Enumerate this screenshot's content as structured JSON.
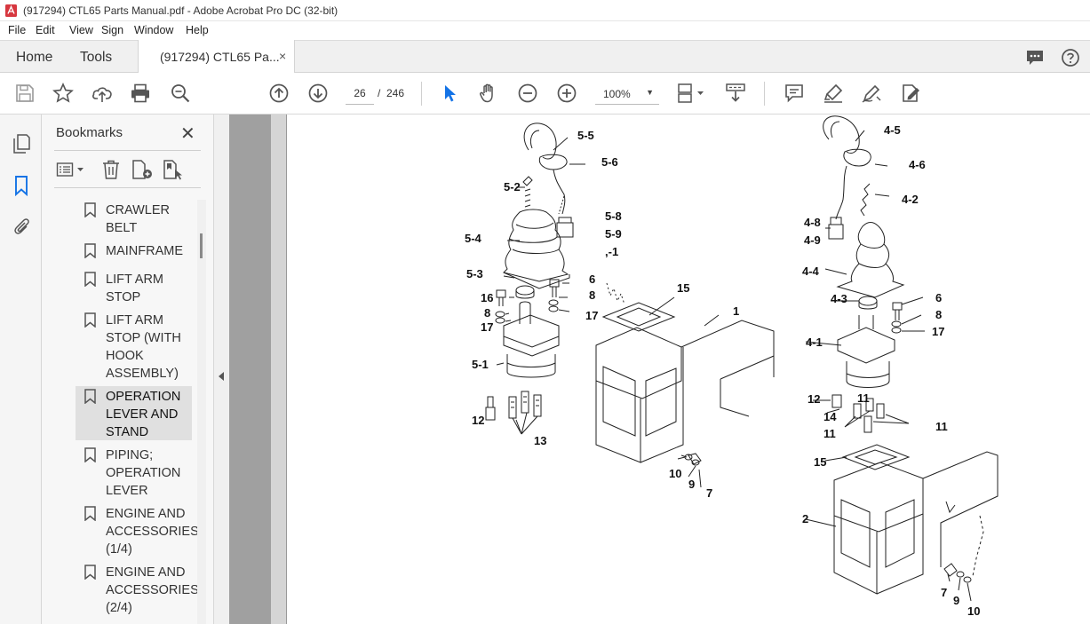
{
  "window": {
    "title": "(917294) CTL65 Parts Manual.pdf - Adobe Acrobat Pro DC (32-bit)"
  },
  "menu": [
    "File",
    "Edit",
    "View",
    "Sign",
    "Window",
    "Help"
  ],
  "tabs": {
    "home": "Home",
    "tools": "Tools",
    "document": "(917294) CTL65 Pa...",
    "close_glyph": "×"
  },
  "toolbar": {
    "page_current": "26",
    "page_separator": "/",
    "page_total": "246",
    "zoom": "100%",
    "zoom_arrow": "▼",
    "icons": [
      "save-icon",
      "bookmark-star-icon",
      "upload-icon",
      "print-icon",
      "search-zoom-icon",
      "page-up-icon",
      "page-down-icon",
      "select-cursor-icon",
      "hand-icon",
      "zoom-out-icon",
      "zoom-in-icon",
      "page-view-icon",
      "scroll-mode-icon",
      "comment-icon",
      "highlight-icon",
      "draw-icon",
      "fill-sign-icon"
    ]
  },
  "bookmarks": {
    "title": "Bookmarks",
    "close_glyph": "✕",
    "items": [
      {
        "label": "CRAWLER BELT"
      },
      {
        "label": "MAINFRAME"
      },
      {
        "label": "LIFT ARM STOP"
      },
      {
        "label": "LIFT ARM STOP (WITH HOOK ASSEMBLY)"
      },
      {
        "label": "OPERATION LEVER AND STAND",
        "selected": true
      },
      {
        "label": "PIPING; OPERATION LEVER"
      },
      {
        "label": "ENGINE AND ACCESSORIES (1/4)"
      },
      {
        "label": "ENGINE AND ACCESSORIES (2/4)"
      }
    ]
  },
  "callouts": {
    "left": [
      "5-5",
      "5-6",
      "5-2",
      "5-8",
      "5-9",
      "5-4",
      ",-1",
      "5-3",
      "6",
      "8",
      "17",
      "16",
      "8",
      "17",
      "5-1",
      "12",
      "13",
      "15",
      "1",
      "10",
      "9",
      "7"
    ],
    "right": [
      "4-5",
      "4-6",
      "4-2",
      "4-8",
      "4-9",
      "4-4",
      "4-3",
      "6",
      "8",
      "17",
      "4-1",
      "12",
      "11",
      "14",
      "11",
      "11",
      "15",
      "2",
      "7",
      "9",
      "10"
    ]
  },
  "colors": {
    "accent_blue": "#1473e6",
    "acrobat_red": "#d7373f",
    "toolbar_bg": "#ffffff",
    "tabbar_bg": "#f0f0f0",
    "doc_bg": "#a0a0a0"
  }
}
